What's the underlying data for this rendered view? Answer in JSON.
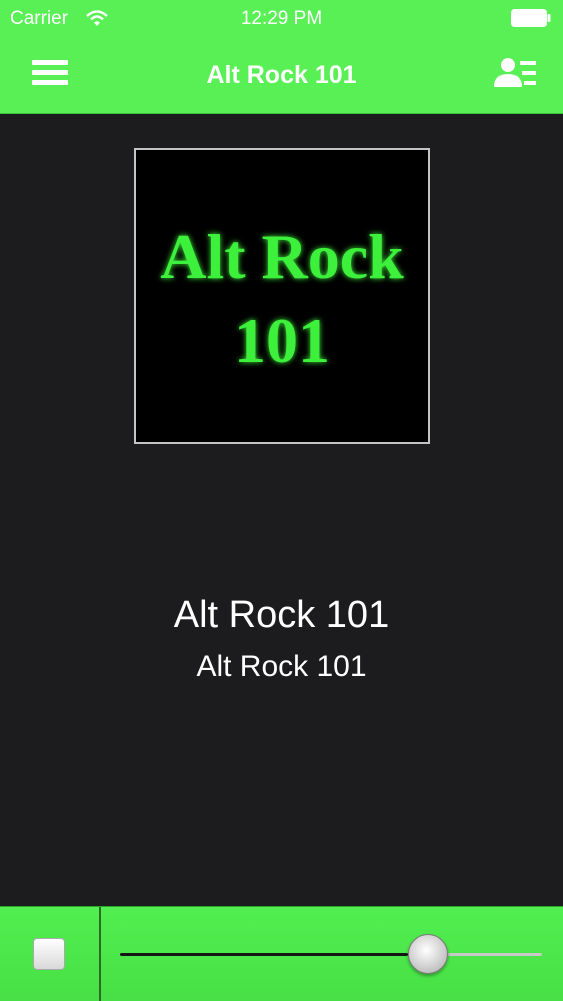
{
  "status_bar": {
    "carrier": "Carrier",
    "time": "12:29 PM"
  },
  "nav": {
    "title": "Alt Rock 101",
    "menu_icon": "hamburger-menu-icon",
    "profile_icon": "user-list-icon"
  },
  "artwork": {
    "line1": "Alt Rock",
    "line2": "101",
    "text_color": "#3cf03a"
  },
  "now_playing": {
    "title": "Alt Rock 101",
    "subtitle": "Alt Rock 101"
  },
  "player": {
    "stop_icon": "stop-icon",
    "volume": 0.73
  },
  "colors": {
    "accent": "#58f055",
    "background": "#1c1c1e"
  }
}
